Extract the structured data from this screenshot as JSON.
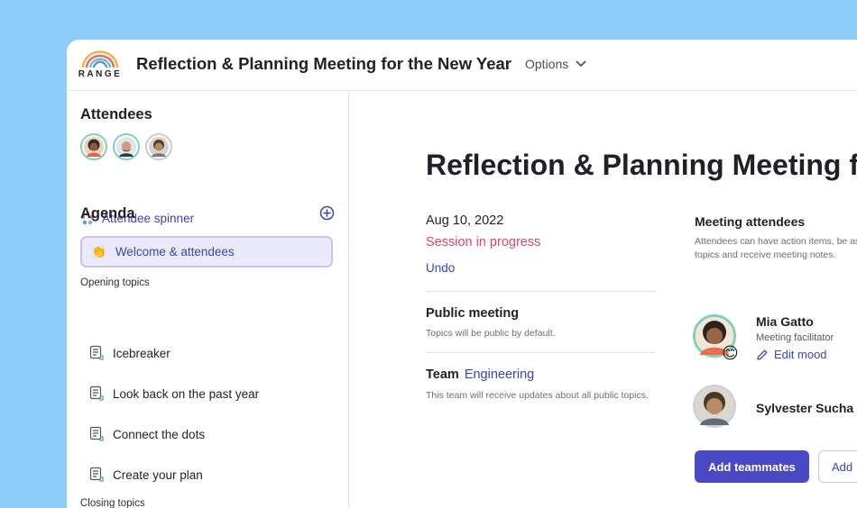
{
  "app": {
    "logo_text": "RANGE",
    "title": "Reflection & Planning Meeting for the New Year",
    "options_label": "Options"
  },
  "sidebar": {
    "attendees_heading": "Attendees",
    "spinner_label": "Attendee spinner",
    "agenda_heading": "Agenda",
    "active_item": {
      "emoji": "👏",
      "label": "Welcome & attendees"
    },
    "opening_label": "Opening topics",
    "opening_items": [
      {
        "label": "Icebreaker"
      },
      {
        "label": "Look back on the past year"
      },
      {
        "label": "Connect the dots"
      },
      {
        "label": "Create your plan"
      }
    ],
    "closing_label": "Closing topics"
  },
  "main": {
    "title": "Reflection & Planning Meeting for the New Year",
    "date": "Aug 10, 2022",
    "session_status": "Session in progress",
    "undo_label": "Undo",
    "public_heading": "Public meeting",
    "public_desc": "Topics will be public by default.",
    "team_heading": "Team",
    "team_name": "Engineering",
    "team_desc": "This team will receive updates about all public topics."
  },
  "attendees_panel": {
    "heading": "Meeting attendees",
    "desc": "Attendees can have action items, be assigned topics and receive meeting notes.",
    "people": [
      {
        "name": "Mia Gatto",
        "role": "Meeting facilitator",
        "mood_emoji": "😊",
        "edit_mood_label": "Edit mood"
      },
      {
        "name": "Sylvester Sucha"
      }
    ],
    "add_teammates_label": "Add teammates",
    "add_label": "Add"
  },
  "colors": {
    "background": "#8ecdf9",
    "accent": "#3b44b8",
    "primary_button": "#4a49c5",
    "session_status": "#e0456a",
    "active_agenda_bg": "#ebeafc",
    "facilitator_ring": "#7dd3b4"
  },
  "icons": {
    "options": "chevron-down-icon",
    "spinner": "dots-cluster-icon",
    "add_agenda": "plus-circle-icon",
    "topic": "topic-document-icon",
    "edit_mood": "pencil-icon"
  }
}
